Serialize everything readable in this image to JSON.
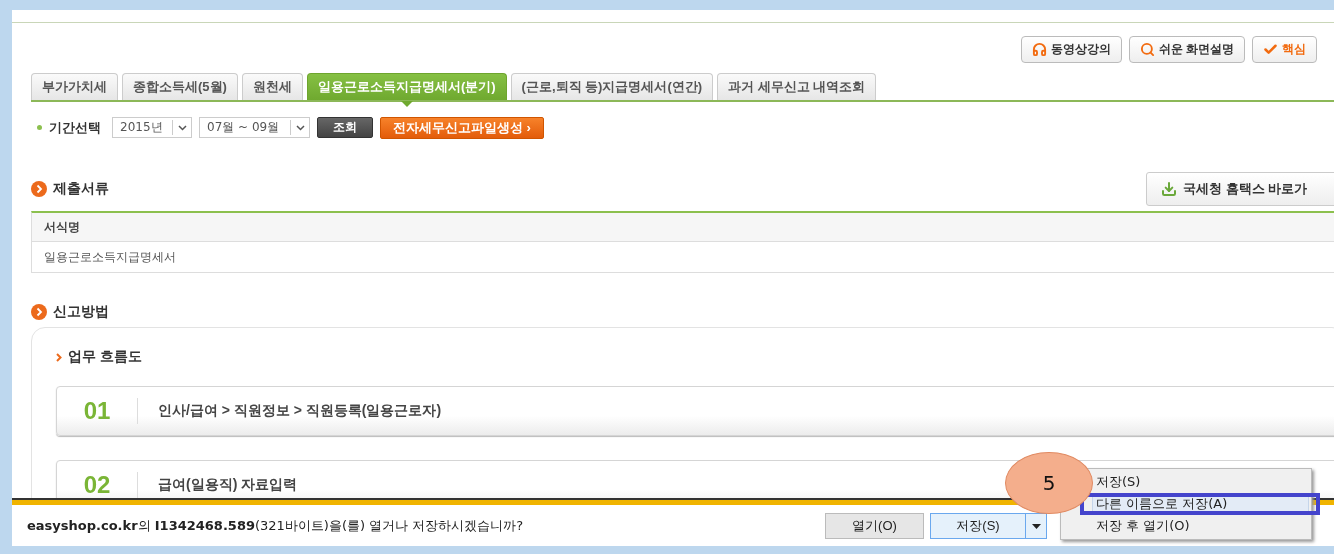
{
  "header_buttons": [
    {
      "label": "동영상강의",
      "kind": "video"
    },
    {
      "label": "쉬운 화면설명",
      "kind": "search"
    },
    {
      "label": "핵심",
      "kind": "check"
    }
  ],
  "tabs": [
    {
      "label": "부가가치세",
      "selected": false
    },
    {
      "label": "종합소득세(5월)",
      "selected": false
    },
    {
      "label": "원천세",
      "selected": false
    },
    {
      "label": "일용근로소득지급명세서(분기)",
      "selected": true
    },
    {
      "label": "(근로,퇴직 등)지급명세서(연간)",
      "selected": false
    },
    {
      "label": "과거 세무신고 내역조회",
      "selected": false
    }
  ],
  "period": {
    "label": "기간선택",
    "year": "2015년",
    "months": "07월 ~ 09월",
    "search_button": "조회",
    "generate_button": "전자세무신고파일생성 ›"
  },
  "documents": {
    "title": "제출서류",
    "link_button": "국세청 홈택스 바로가",
    "columns": [
      "서식명"
    ],
    "rows": [
      "일용근로소득지급명세서"
    ]
  },
  "method": {
    "title": "신고방법",
    "subtitle": "업무 흐름도",
    "steps": [
      {
        "number": "01",
        "text": "인사/급여 > 직원정보 > 직원등록(일용근로자)"
      },
      {
        "number": "02",
        "text": "급여(일용직) 자료입력"
      }
    ]
  },
  "download_bar": {
    "message": "**easyshop.co.kr**의 **I1342468.589**(321바이트)을(를) 열거나 저장하시겠습니까?",
    "open_button": "열기(O)",
    "save_button": "저장(S)",
    "menu": [
      {
        "label": "저장(S)",
        "selected": false
      },
      {
        "label": "다른 이름으로 저장(A)",
        "selected": true
      },
      {
        "label": "저장 후 열기(O)",
        "selected": false
      }
    ]
  },
  "annotation": {
    "number": "5"
  }
}
